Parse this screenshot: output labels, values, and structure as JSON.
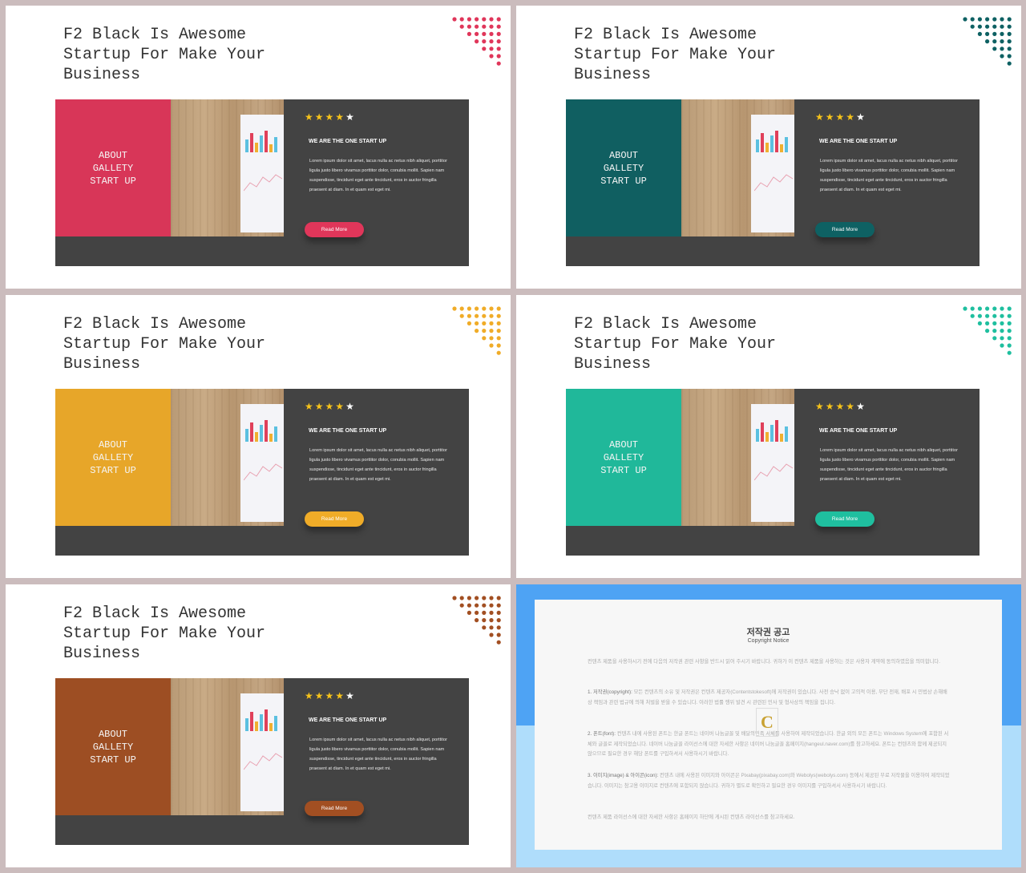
{
  "slides": [
    {
      "title": "F2 Black Is Awesome\nStartup For Make Your\nBusiness",
      "block_text": "ABOUT\nGALLETY\nSTART UP",
      "rating": 4,
      "max_rating": 5,
      "heading": "WE ARE THE ONE START UP",
      "body": "Lorem  ipsum dolor sit amet, lacus nulla ac netus nibh aliquet, porttitor  ligula justo libero vivamus porttitor dolor, conubia mollit. Sapien nam suspendisse, tincidunt eget  ante tincidunt, eros in auctor fringilla praesent at diam.  In et  quam est eget mi.",
      "button": "Read More",
      "accent": "#e0365a"
    },
    {
      "title": "F2 Black Is Awesome\nStartup For Make Your\nBusiness",
      "block_text": "ABOUT\nGALLETY\nSTART UP",
      "rating": 4,
      "max_rating": 5,
      "heading": "WE ARE THE ONE START UP",
      "body": "Lorem  ipsum dolor sit amet, lacus nulla ac netus nibh aliquet, porttitor  ligula justo libero vivamus porttitor dolor, conubia mollit. Sapien nam suspendisse, tincidunt eget  ante tincidunt, eros in auctor fringilla praesent at diam.  In et  quam est eget mi.",
      "button": "Read More",
      "accent": "#0e6163"
    },
    {
      "title": "F2 Black Is Awesome\nStartup For Make Your\nBusiness",
      "block_text": "ABOUT\nGALLETY\nSTART UP",
      "rating": 4,
      "max_rating": 5,
      "heading": "WE ARE THE ONE START UP",
      "body": "Lorem  ipsum dolor sit amet, lacus nulla ac netus nibh aliquet, porttitor  ligula justo libero vivamus porttitor dolor, conubia mollit. Sapien nam suspendisse, tincidunt eget  ante tincidunt, eros in auctor fringilla praesent at diam.  In et  quam est eget mi.",
      "button": "Read More",
      "accent": "#f0ac28"
    },
    {
      "title": "F2 Black Is Awesome\nStartup For Make Your\nBusiness",
      "block_text": "ABOUT\nGALLETY\nSTART UP",
      "rating": 4,
      "max_rating": 5,
      "heading": "WE ARE THE ONE START UP",
      "body": "Lorem  ipsum dolor sit amet, lacus nulla ac netus nibh aliquet, porttitor  ligula justo libero vivamus porttitor dolor, conubia mollit. Sapien nam suspendisse, tincidunt eget  ante tincidunt, eros in auctor fringilla praesent at diam.  In et  quam est eget mi.",
      "button": "Read More",
      "accent": "#1fbf9f"
    },
    {
      "title": "F2 Black Is Awesome\nStartup For Make Your\nBusiness",
      "block_text": "ABOUT\nGALLETY\nSTART UP",
      "rating": 4,
      "max_rating": 5,
      "heading": "WE ARE THE ONE START UP",
      "body": "Lorem  ipsum dolor sit amet, lacus nulla ac netus nibh aliquet, porttitor  ligula justo libero vivamus porttitor dolor, conubia mollit. Sapien nam suspendisse, tincidunt eget  ante tincidunt, eros in auctor fringilla praesent at diam.  In et  quam est eget mi.",
      "button": "Read More",
      "accent": "#a24f22"
    }
  ],
  "copyright": {
    "title": "저작권 공고",
    "subtitle": "Copyright Notice",
    "intro": "컨텐츠 제품을 사용하시기 전에 다음의 저작권 관련 사항을 반드시 읽어 주시기 바랍니다. 귀하가 이 컨텐츠 제품을 사용하는 것은 사용자 계약에 동의하였음을 의미합니다.",
    "items": [
      {
        "label": "1. 저작권(copyright):",
        "text": " 모든 컨텐츠의 소유 및 저작권은 컨텐츠 제공자(Contentstokesoft)에 저작권이 있습니다. 사전 승낙 없이 고의적 이용, 무단 전재, 배포 시 민법상 손해배상 책임과 관련 법규에 의해 처벌을 받을 수 있습니다. 이러한 법률 행위 발견 시 관련된 민사 및 형사상의 책임을 집니다."
      },
      {
        "label": "2. 폰트(font):",
        "text": " 컨텐츠 내에 사용된 폰트는 한글 폰트는 네이버 나눔글꼴 및 배달의민족 서체를 사용하여 제작되었습니다. 한글 외의 모든 폰트는 Windows System에 포함된 서체와 글꼴로 제작되었습니다. 네이버 나눔글꼴 라이선스에 대한 자세한 사항은 네이버 나눔글꼴 홈페이지(hangeul.naver.com)를 참고하세요. 폰트는 컨텐츠와 함께 제공되지 않으므로 필요한 경우 해당 폰트를 구입하셔서 사용하시기 바랍니다."
      },
      {
        "label": "3. 이미지(image) & 아이콘(icon):",
        "text": " 컨텐츠 내에 사용된 이미지와 아이콘은 Pixabay(pixabay.com)와 Webolys(webolys.com) 등에서 제공된 무료 저작물을 이용하여 제작되었습니다. 이미지는 참고용 이미지로 컨텐츠에 포함되지 않습니다. 귀하가 별도로 확인하고 필요한 경우 이미지를 구입하셔서 사용하시기 바랍니다."
      }
    ],
    "footer": "컨텐츠 제품 라이선스에 대한 자세한 사항은 홈페이지 하단에 게시된 컨텐츠 라이선스를 참고하세요.",
    "logo_letter": "C"
  }
}
